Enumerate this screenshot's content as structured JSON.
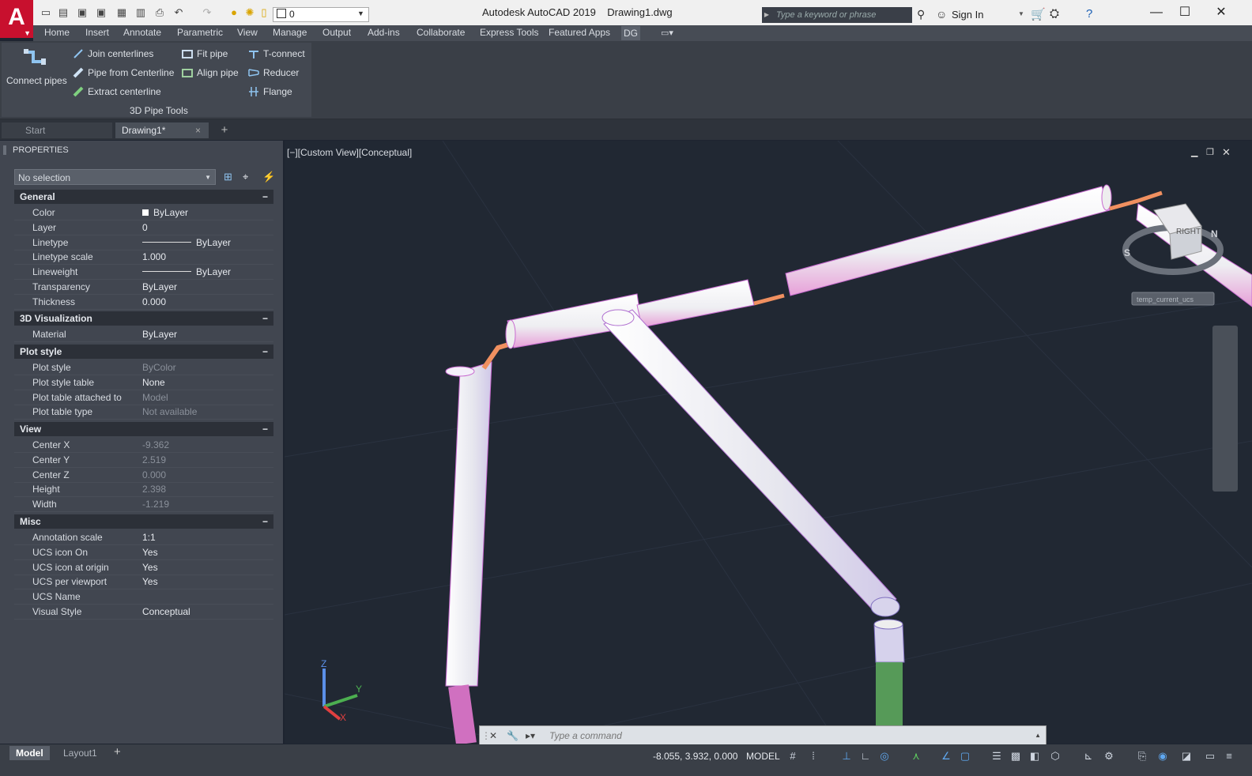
{
  "app": {
    "logo": "A",
    "title": "Autodesk AutoCAD 2019",
    "file": "Drawing1.dwg"
  },
  "toolbar": {
    "layer": "0"
  },
  "search": {
    "placeholder": "Type a keyword or phrase"
  },
  "account": {
    "sign_in": "Sign In"
  },
  "menu": [
    "Home",
    "Insert",
    "Annotate",
    "Parametric",
    "View",
    "Manage",
    "Output",
    "Add-ins",
    "Collaborate",
    "Express Tools",
    "Featured Apps",
    "DG"
  ],
  "ribbon": {
    "big_button": "Connect pipes",
    "buttons": [
      "Join centerlines",
      "Pipe from Centerline",
      "Extract centerline",
      "Fit pipe",
      "Align pipe",
      "T-connect",
      "Reducer",
      "Flange"
    ],
    "panel_title": "3D Pipe Tools"
  },
  "doc_tabs": [
    "Start",
    "Drawing1*"
  ],
  "properties": {
    "title": "PROPERTIES",
    "selection": "No selection",
    "sections": [
      {
        "name": "General",
        "rows": [
          {
            "k": "Color",
            "v": "ByLayer"
          },
          {
            "k": "Layer",
            "v": "0"
          },
          {
            "k": "Linetype",
            "v": "ByLayer"
          },
          {
            "k": "Linetype scale",
            "v": "1.000"
          },
          {
            "k": "Lineweight",
            "v": "ByLayer"
          },
          {
            "k": "Transparency",
            "v": "ByLayer"
          },
          {
            "k": "Thickness",
            "v": "0.000"
          }
        ]
      },
      {
        "name": "3D Visualization",
        "rows": [
          {
            "k": "Material",
            "v": "ByLayer"
          }
        ]
      },
      {
        "name": "Plot style",
        "rows": [
          {
            "k": "Plot style",
            "v": "ByColor"
          },
          {
            "k": "Plot style table",
            "v": "None"
          },
          {
            "k": "Plot table attached to",
            "v": "Model"
          },
          {
            "k": "Plot table type",
            "v": "Not available"
          }
        ]
      },
      {
        "name": "View",
        "rows": [
          {
            "k": "Center X",
            "v": "-9.362"
          },
          {
            "k": "Center Y",
            "v": "2.519"
          },
          {
            "k": "Center Z",
            "v": "0.000"
          },
          {
            "k": "Height",
            "v": "2.398"
          },
          {
            "k": "Width",
            "v": "-1.219"
          }
        ]
      },
      {
        "name": "Misc",
        "rows": [
          {
            "k": "Annotation scale",
            "v": "1:1"
          },
          {
            "k": "UCS icon On",
            "v": "Yes"
          },
          {
            "k": "UCS icon at origin",
            "v": "Yes"
          },
          {
            "k": "UCS per viewport",
            "v": "Yes"
          },
          {
            "k": "UCS Name",
            "v": ""
          },
          {
            "k": "Visual Style",
            "v": "Conceptual"
          }
        ]
      }
    ]
  },
  "viewport": {
    "label": "[−][Custom View][Conceptual]",
    "ucs_tag": "temp_current_ucs",
    "viewcube_face": "RIGHT",
    "compass": [
      "S",
      "N"
    ],
    "axes": [
      "Z",
      "Y",
      "X"
    ]
  },
  "command": {
    "placeholder": "Type a command"
  },
  "layout_tabs": [
    "Model",
    "Layout1"
  ],
  "status": {
    "coords": "-8.055, 3.932, 0.000",
    "space": "MODEL"
  }
}
